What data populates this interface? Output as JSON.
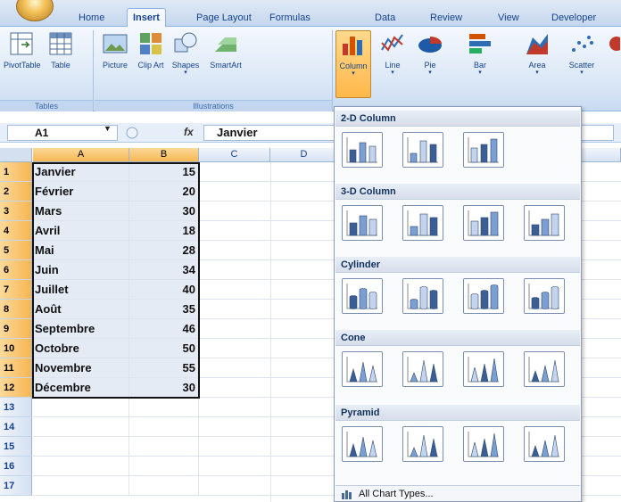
{
  "tabs": [
    "Home",
    "Insert",
    "Page Layout",
    "Formulas",
    "Data",
    "Review",
    "View",
    "Developer"
  ],
  "active_tab": "Insert",
  "ribbon": {
    "groups": [
      "Tables",
      "Illustrations"
    ],
    "buttons": {
      "pivottable": "PivotTable",
      "table": "Table",
      "picture": "Picture",
      "clip_art": "Clip Art",
      "shapes": "Shapes",
      "smartart": "SmartArt",
      "column": "Column",
      "line": "Line",
      "pie": "Pie",
      "bar": "Bar",
      "area": "Area",
      "scatter": "Scatter"
    },
    "accent_color": "#ffb84a"
  },
  "formula_bar": {
    "name_box": "A1",
    "fx_label": "fx",
    "formula": "Janvier"
  },
  "sheet": {
    "columns": [
      "A",
      "B",
      "C",
      "D"
    ],
    "rows": [
      "1",
      "2",
      "3",
      "4",
      "5",
      "6",
      "7",
      "8",
      "9",
      "10",
      "11",
      "12",
      "13",
      "14",
      "15",
      "16",
      "17"
    ],
    "data": [
      {
        "month": "Janvier",
        "value": "15"
      },
      {
        "month": "Février",
        "value": "20"
      },
      {
        "month": "Mars",
        "value": "30"
      },
      {
        "month": "Avril",
        "value": "18"
      },
      {
        "month": "Mai",
        "value": "28"
      },
      {
        "month": "Juin",
        "value": "34"
      },
      {
        "month": "Juillet",
        "value": "40"
      },
      {
        "month": "Août",
        "value": "35"
      },
      {
        "month": "Septembre",
        "value": "46"
      },
      {
        "month": "Octobre",
        "value": "50"
      },
      {
        "month": "Novembre",
        "value": "55"
      },
      {
        "month": "Décembre",
        "value": "30"
      }
    ]
  },
  "gallery": {
    "sections": [
      "2-D Column",
      "3-D Column",
      "Cylinder",
      "Cone",
      "Pyramid"
    ],
    "footer": "All Chart Types..."
  }
}
